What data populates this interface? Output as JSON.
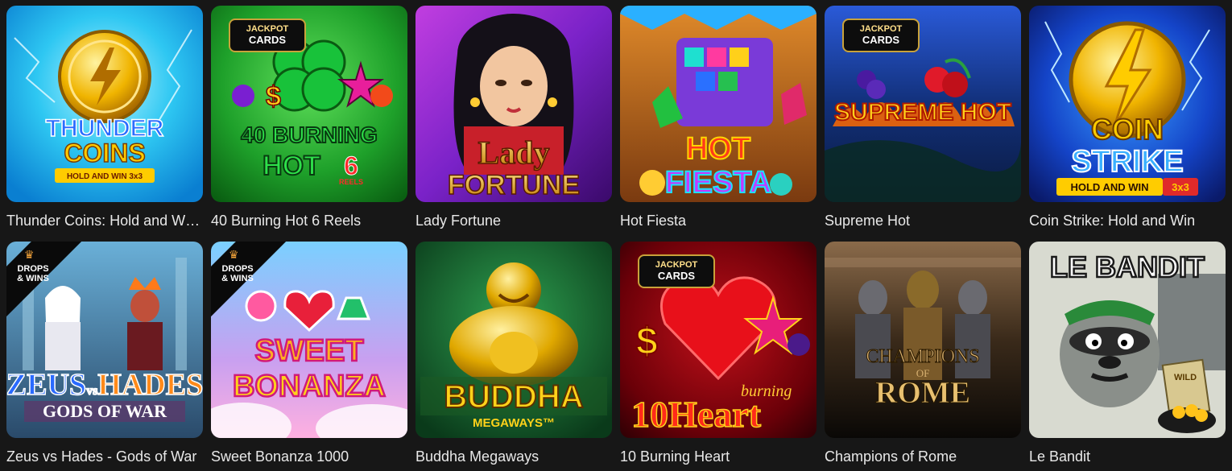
{
  "games": [
    {
      "title": "Thunder Coins: Hold and Win 3x3",
      "art": [
        "THUNDER",
        "COINS",
        "HOLD AND WIN 3x3"
      ]
    },
    {
      "title": "40 Burning Hot 6 Reels",
      "art": [
        "JACKPOT",
        "CARDS",
        "40 BURNING",
        "HOT",
        "6",
        "REELS"
      ]
    },
    {
      "title": "Lady Fortune",
      "art": [
        "Lady",
        "FORTUNE"
      ]
    },
    {
      "title": "Hot Fiesta",
      "art": [
        "HOT",
        "FIESTA"
      ]
    },
    {
      "title": "Supreme Hot",
      "art": [
        "JACKPOT",
        "CARDS",
        "SUPREME HOT"
      ]
    },
    {
      "title": "Coin Strike: Hold and Win",
      "art": [
        "COIN",
        "STRIKE",
        "HOLD AND WIN",
        "3x3"
      ]
    },
    {
      "title": "Zeus vs Hades - Gods of War",
      "art": [
        "DROPS",
        "& WINS",
        "ZEUS",
        "vs",
        "HADES",
        "GODS OF WAR"
      ]
    },
    {
      "title": "Sweet Bonanza 1000",
      "art": [
        "DROPS",
        "& WINS",
        "SWEET",
        "BONANZA"
      ]
    },
    {
      "title": "Buddha Megaways",
      "art": [
        "BUDDHA",
        "MEGAWAYS™"
      ]
    },
    {
      "title": "10 Burning Heart",
      "art": [
        "JACKPOT",
        "CARDS",
        "10",
        "Heart",
        "burning"
      ]
    },
    {
      "title": "Champions of Rome",
      "art": [
        "CHAMPIONS",
        "OF",
        "ROME"
      ]
    },
    {
      "title": "Le Bandit",
      "art": [
        "LE BANDIT",
        "WILD"
      ]
    }
  ]
}
